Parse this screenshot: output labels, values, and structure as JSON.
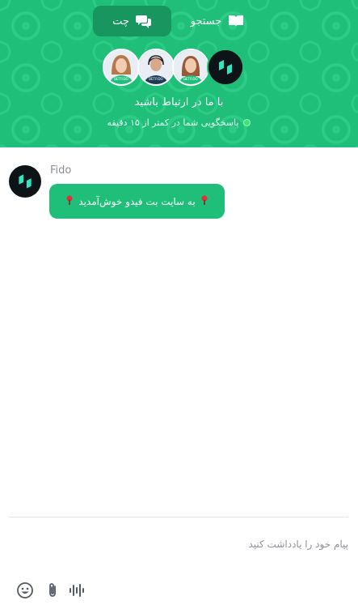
{
  "header": {
    "tabs": [
      {
        "label": "چت",
        "icon": "chat-bubbles-icon",
        "active": true
      },
      {
        "label": "جستجو",
        "icon": "book-icon",
        "active": false
      }
    ],
    "title": "با ما در ارتباط باشید",
    "status_text": "پاسخگویی شما در کمتر از ۱۵ دقیقه",
    "status_color": "#39e56c",
    "agent_badge": "BETFIDO"
  },
  "conversation": {
    "sender": "Fido",
    "message": "به سایت بت فیدو خوش‌آمدید",
    "message_icon": "pin-icon"
  },
  "composer": {
    "placeholder": "پیام خود را یادداشت کنید"
  },
  "toolbar": {
    "icons": [
      "emoji-icon",
      "attachment-icon",
      "voice-icon"
    ]
  },
  "colors": {
    "brand": "#1fbf7a",
    "brand_dark": "#17965f",
    "logo_bg": "#0d1417",
    "logo_accent": "#2ee6c0"
  }
}
